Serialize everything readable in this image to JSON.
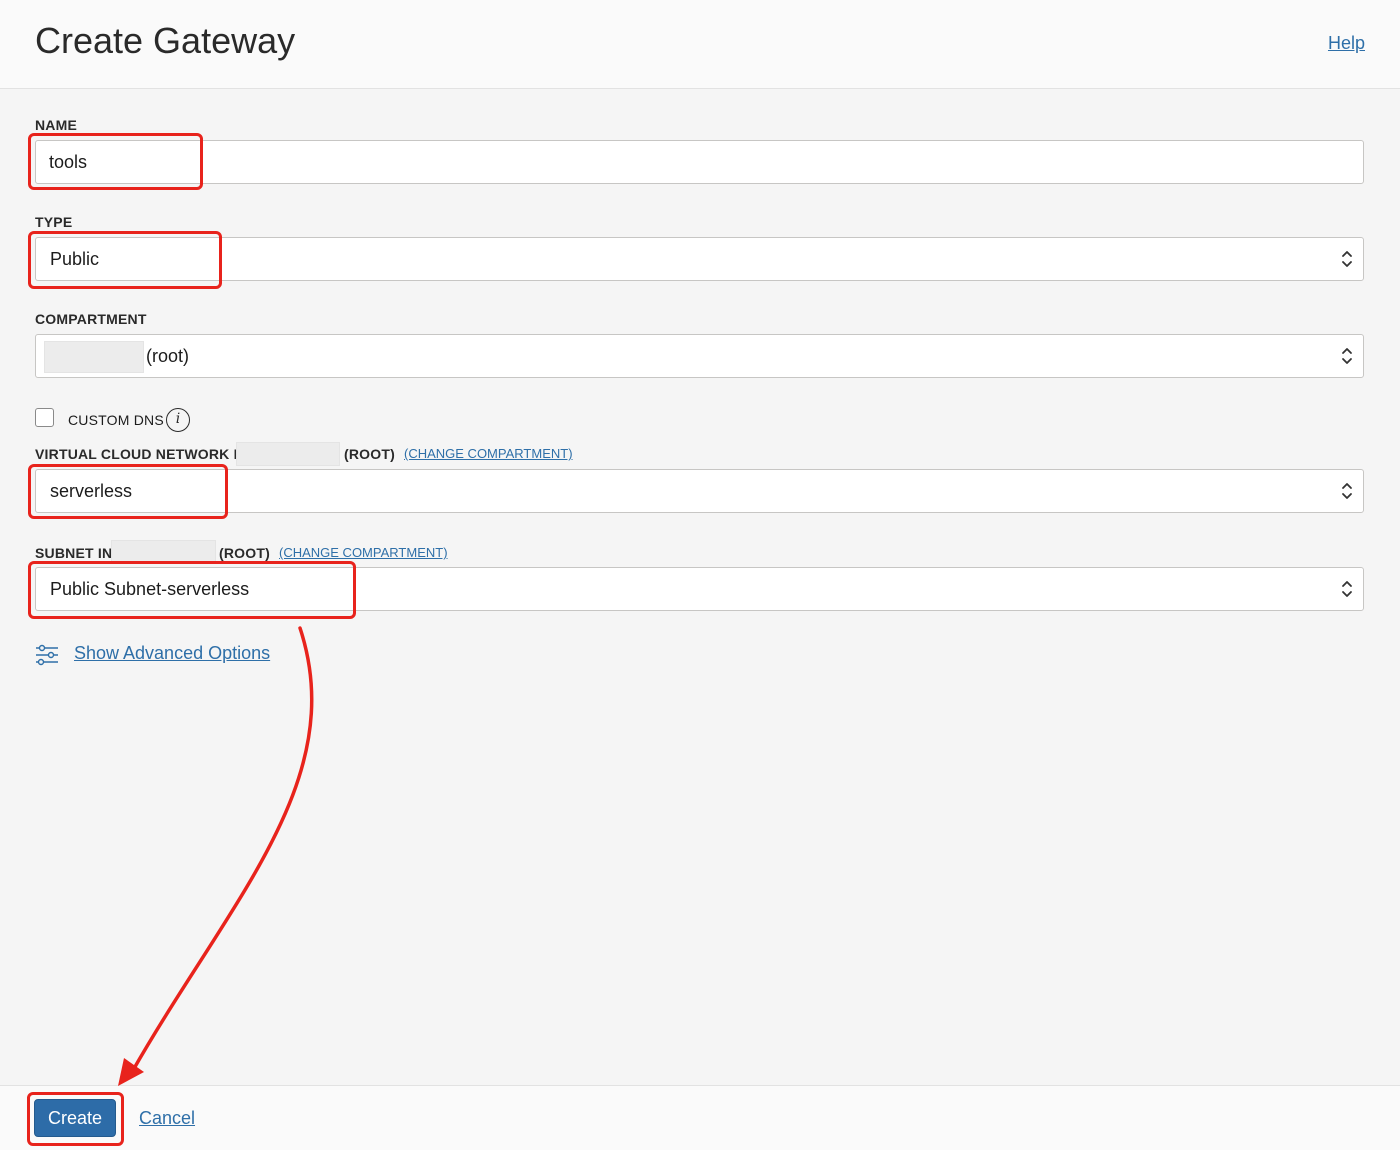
{
  "header": {
    "title": "Create Gateway",
    "help_label": "Help"
  },
  "form": {
    "name": {
      "label": "NAME",
      "value": "tools"
    },
    "type": {
      "label": "TYPE",
      "value": "Public"
    },
    "compartment": {
      "label": "COMPARTMENT",
      "value_suffix": "(root)"
    },
    "custom_dns": {
      "label": "CUSTOM DNS",
      "checked": false,
      "info_glyph": "i"
    },
    "vcn": {
      "label": "VIRTUAL CLOUD NETWORK IN",
      "root_label": "(ROOT)",
      "change_label": "(CHANGE COMPARTMENT)",
      "value": "serverless"
    },
    "subnet": {
      "label": "SUBNET IN",
      "root_label": "(ROOT)",
      "change_label": "(CHANGE COMPARTMENT)",
      "value": "Public Subnet-serverless"
    },
    "advanced_options_label": "Show Advanced Options"
  },
  "footer": {
    "create_label": "Create",
    "cancel_label": "Cancel"
  },
  "icons": {
    "select_chevron": "chevron-up-down-icon",
    "info": "info-icon",
    "advanced": "sliders-icon"
  },
  "colors": {
    "accent": "#2d6ca8",
    "link": "#2e6fa8",
    "annotation": "#e8231c"
  }
}
